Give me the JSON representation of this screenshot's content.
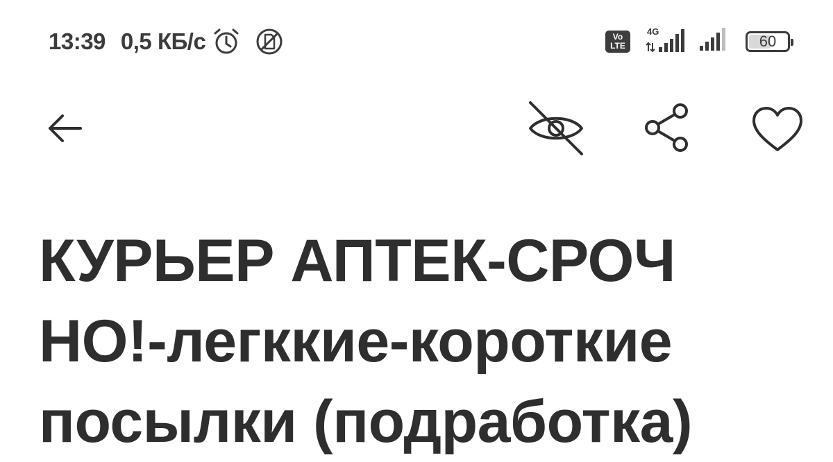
{
  "status_bar": {
    "time": "13:39",
    "speed": "0,5 КБ/с",
    "icons": [
      "alarm-clock-icon",
      "no-sim-icon"
    ],
    "volte": {
      "top": "Vo",
      "bottom": "LTE"
    },
    "network_type": "4G",
    "signal_icons": [
      "signal-bars-icon",
      "signal-bars-icon"
    ],
    "battery": {
      "label": "60",
      "level": 0.6
    }
  },
  "toolbar": {
    "icons": [
      "back-arrow-icon",
      "hide-eye-icon",
      "share-icon",
      "heart-icon"
    ]
  },
  "title": {
    "lines": [
      "КУРЬЕР АПТЕК-СРОЧ",
      "НО!-легккие-короткие",
      "посылки (подработка)"
    ]
  },
  "colors": {
    "text": "#2e2e2e",
    "background": "#ffffff"
  }
}
